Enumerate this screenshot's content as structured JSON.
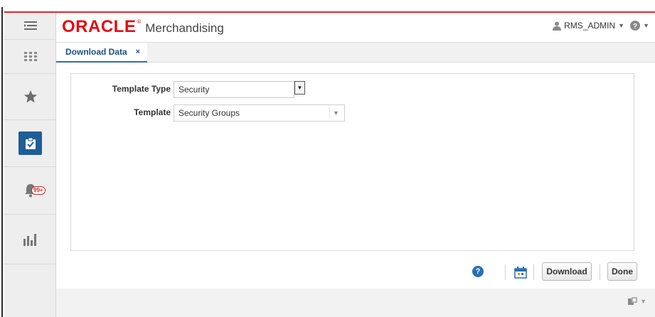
{
  "brand": {
    "oracle": "ORACLE",
    "registered": "®",
    "app_name": "Merchandising",
    "accent": "#e30d14"
  },
  "user": {
    "name": "RMS_ADMIN",
    "user_icon": "user-icon",
    "help_icon": "help-icon"
  },
  "rail": {
    "items": [
      {
        "name": "navigator",
        "icon": "hamburger-icon"
      },
      {
        "name": "apps",
        "icon": "grid-icon"
      },
      {
        "name": "favorites",
        "icon": "star-icon"
      },
      {
        "name": "tasks",
        "icon": "tasks-icon",
        "active": true,
        "active_color": "#1f5e94"
      },
      {
        "name": "notifications",
        "icon": "bell-icon",
        "badge": "99+"
      },
      {
        "name": "reports",
        "icon": "bar-chart-icon"
      }
    ]
  },
  "tabs": [
    {
      "label": "Download Data",
      "close": "×",
      "active": true
    }
  ],
  "form": {
    "template_type": {
      "label": "Template Type",
      "value": "Security"
    },
    "template": {
      "label": "Template",
      "value": "Security Groups"
    }
  },
  "footer": {
    "download_label": "Download",
    "done_label": "Done",
    "help_glyph": "?"
  }
}
